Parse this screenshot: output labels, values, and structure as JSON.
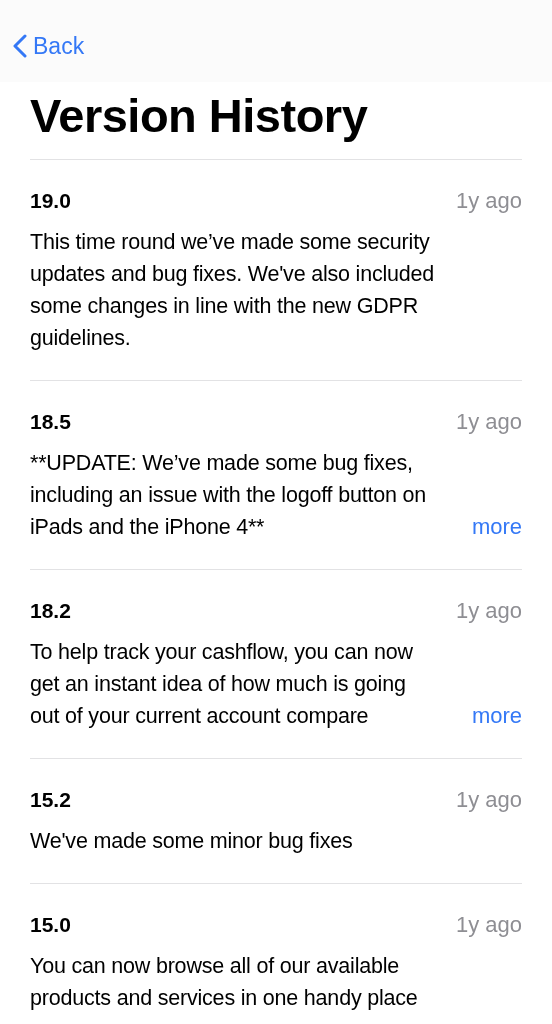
{
  "nav": {
    "back_label": "Back"
  },
  "title": "Version History",
  "versions": [
    {
      "version": "19.0",
      "age": "1y ago",
      "note_lines": [
        "This time round we’ve made some security",
        "updates and bug fixes. We've also included",
        "some changes in line with the new GDPR",
        "guidelines."
      ]
    },
    {
      "version": "18.5",
      "age": "1y ago",
      "note_lines": [
        "**UPDATE: We’ve made some bug fixes,",
        "including an issue with the logoff button on",
        "iPads and the iPhone 4**"
      ],
      "more": "more"
    },
    {
      "version": "18.2",
      "age": "1y ago",
      "note_lines": [
        "To help track your cashflow, you can now",
        "get an instant idea of how much is going",
        "out of your current account compare"
      ],
      "more": "more"
    },
    {
      "version": "15.2",
      "age": "1y ago",
      "note_lines": [
        "We've made some minor bug fixes"
      ]
    },
    {
      "version": "15.0",
      "age": "1y ago",
      "note_lines": [
        "You can now browse all of our available",
        "products and services in one handy place"
      ]
    }
  ]
}
